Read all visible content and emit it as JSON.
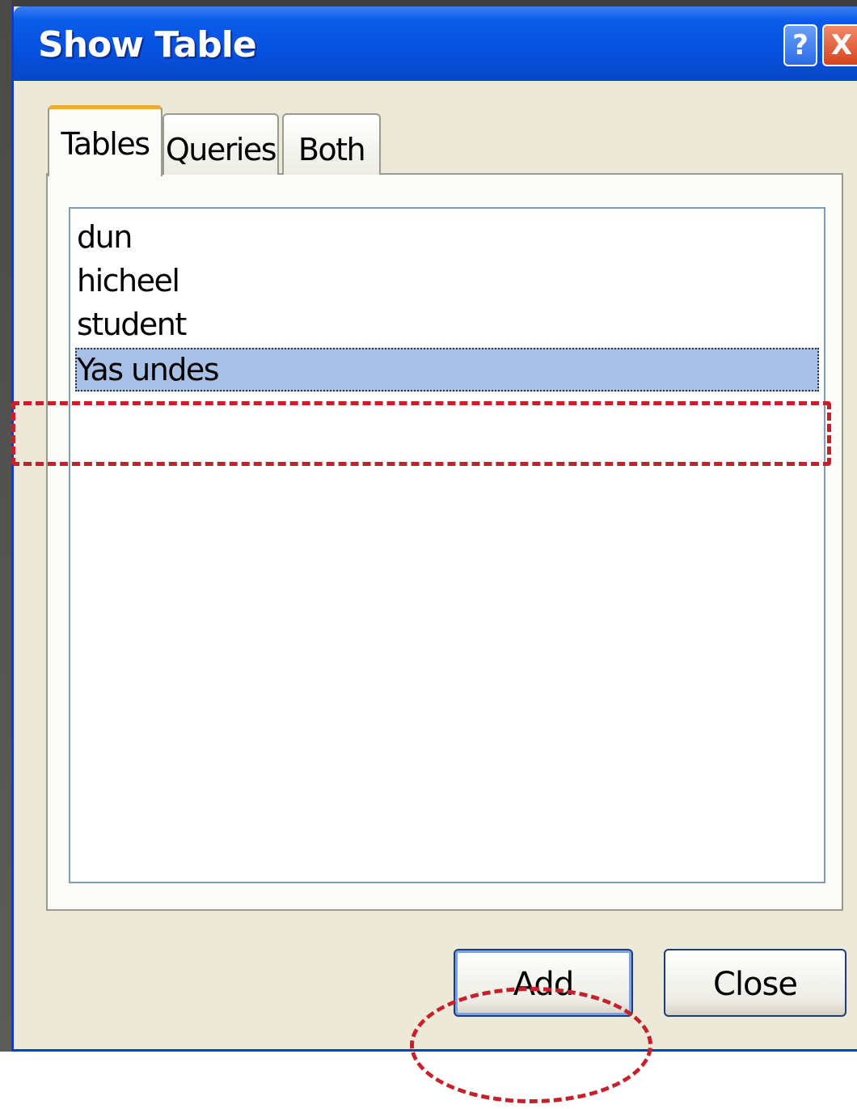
{
  "window": {
    "title": "Show Table",
    "help_label": "?",
    "close_label": "X"
  },
  "tabs": [
    {
      "label": "Tables",
      "active": true
    },
    {
      "label": "Queries",
      "active": false
    },
    {
      "label": "Both",
      "active": false
    }
  ],
  "list": {
    "items": [
      {
        "label": "dun",
        "selected": false
      },
      {
        "label": "hicheel",
        "selected": false
      },
      {
        "label": "student",
        "selected": false
      },
      {
        "label": "Yas undes",
        "selected": true
      }
    ]
  },
  "buttons": {
    "add_label": "Add",
    "close_label": "Close"
  },
  "colors": {
    "title_bar": "#0551e0",
    "selection": "#a9c0e6",
    "annotation": "#c8202a"
  }
}
